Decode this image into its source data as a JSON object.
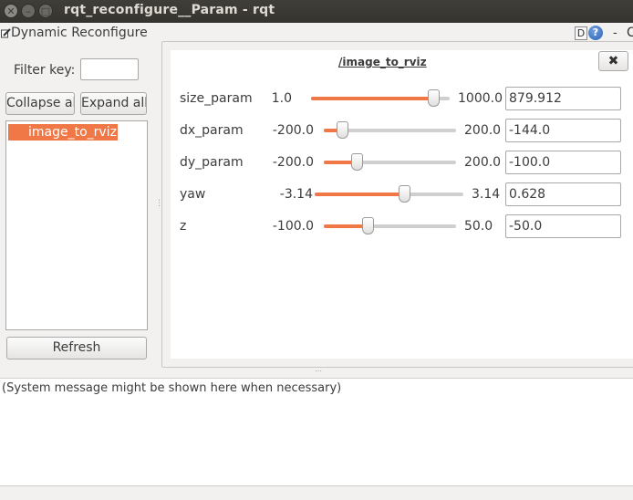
{
  "window": {
    "title": "rqt_reconfigure__Param - rqt"
  },
  "plugin": {
    "title": "Dynamic Reconfigure",
    "d_label": "D",
    "help_label": "?",
    "minimize_label": "-",
    "close_label": "C"
  },
  "sidebar": {
    "filter_label": "Filter key:",
    "filter_value": "",
    "collapse_label": "Collapse all",
    "expand_label": "Expand all",
    "nodes": [
      "image_to_rviz"
    ],
    "refresh_label": "Refresh"
  },
  "node_panel": {
    "title": "/image_to_rviz",
    "close_label": "✖",
    "params": [
      {
        "name": "size_param",
        "min": "1.0",
        "max": "1000.0",
        "value": "879.912",
        "fraction": 0.88
      },
      {
        "name": "dx_param",
        "min": "-200.0",
        "max": "200.0",
        "value": "-144.0",
        "fraction": 0.14
      },
      {
        "name": "dy_param",
        "min": "-200.0",
        "max": "200.0",
        "value": "-100.0",
        "fraction": 0.25
      },
      {
        "name": "yaw",
        "min": "-3.14",
        "max": "3.14",
        "value": "0.628",
        "fraction": 0.6
      },
      {
        "name": "z",
        "min": "-100.0",
        "max": "50.0",
        "value": "-50.0",
        "fraction": 0.33
      }
    ]
  },
  "message": {
    "text": "(System message might be shown here when necessary)"
  },
  "colors": {
    "accent": "#f07746",
    "titlebar": "#3c3b37"
  }
}
